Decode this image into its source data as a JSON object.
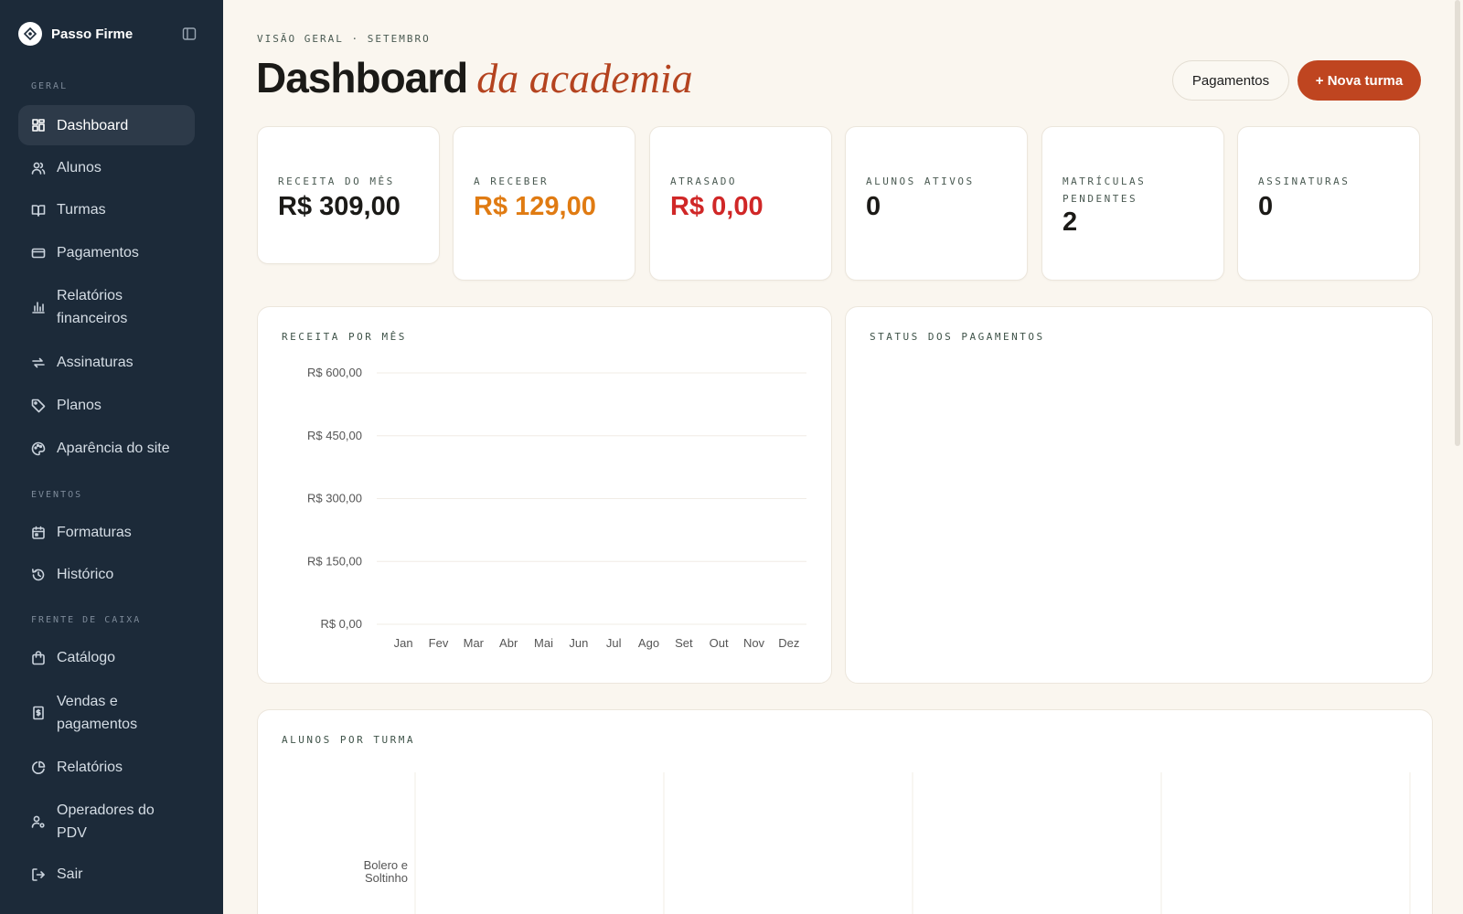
{
  "sidebar": {
    "brand": "Passo Firme",
    "sections": {
      "geral": "GERAL",
      "eventos": "EVENTOS",
      "frente": "FRENTE DE CAIXA"
    },
    "items": {
      "dashboard": "Dashboard",
      "alunos": "Alunos",
      "turmas": "Turmas",
      "pagamentos": "Pagamentos",
      "relatorios_fin_1": "Relatórios",
      "relatorios_fin_2": "financeiros",
      "assinaturas": "Assinaturas",
      "planos": "Planos",
      "aparencia": "Aparência do site",
      "formaturas": "Formaturas",
      "historico": "Histórico",
      "catalogo": "Catálogo",
      "vendas_1": "Vendas e",
      "vendas_2": "pagamentos",
      "relatorios": "Relatórios",
      "operadores_1": "Operadores do",
      "operadores_2": "PDV",
      "sair": "Sair"
    }
  },
  "header": {
    "eyebrow": "VISÃO GERAL · SETEMBRO",
    "title": "Dashboard",
    "title_accent": "da academia",
    "btn_pagamentos": "Pagamentos",
    "btn_nova_turma": "+ Nova turma"
  },
  "kpis": [
    {
      "label": "RECEITA DO MÊS",
      "value": "R$ 309,00"
    },
    {
      "label": "A RECEBER",
      "value": "R$ 129,00"
    },
    {
      "label": "ATRASADO",
      "value": "R$ 0,00"
    },
    {
      "label": "ALUNOS ATIVOS",
      "value": "0"
    },
    {
      "label": "MATRÍCULAS PENDENTES",
      "value": "2"
    },
    {
      "label": "ASSINATURAS",
      "value": "0"
    }
  ],
  "panels": {
    "receita": "RECEITA POR MÊS",
    "status": "STATUS DOS PAGAMENTOS",
    "alunos": "ALUNOS POR TURMA"
  },
  "chart_data": [
    {
      "type": "bar",
      "categories": [
        "Jan",
        "Fev",
        "Mar",
        "Abr",
        "Mai",
        "Jun",
        "Jul",
        "Ago",
        "Set",
        "Out",
        "Nov",
        "Dez"
      ],
      "values": [
        0,
        0,
        0,
        0,
        0,
        0,
        0,
        0,
        0,
        0,
        0,
        0
      ],
      "title": "RECEITA POR MÊS",
      "ylim": [
        0,
        600
      ],
      "yticks": [
        0,
        150,
        300,
        450,
        600
      ],
      "ytick_labels": [
        "R$ 0,00",
        "R$ 150,00",
        "R$ 300,00",
        "R$ 450,00",
        "R$ 600,00"
      ],
      "grid": true
    },
    {
      "type": "bar",
      "orientation": "horizontal",
      "title": "ALUNOS POR TURMA",
      "categories": [
        "Bolero e Soltinho"
      ],
      "category_label_lines": [
        "Bolero e",
        "Soltinho"
      ],
      "values": [
        0
      ],
      "grid": true
    }
  ]
}
